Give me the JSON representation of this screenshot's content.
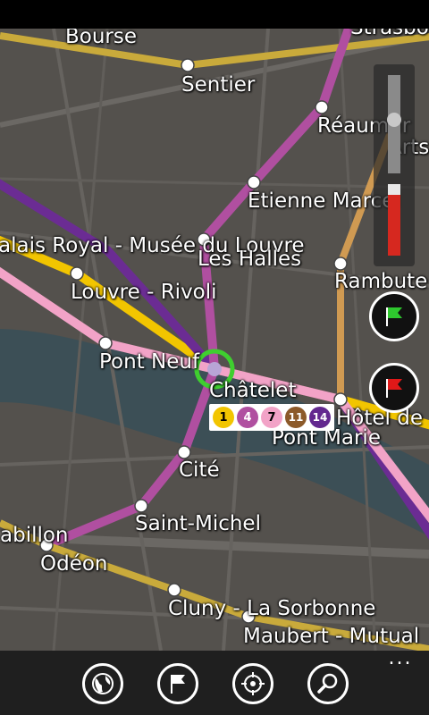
{
  "map": {
    "station_labels": {
      "bourse": "Bourse",
      "sentier": "Sentier",
      "strasbourg": "Strasbo",
      "reaumur": "Réaumur",
      "arts": "Arts",
      "etienne_marcel": "Etienne Marcel",
      "palais_royal": "alais Royal - Musée du Louvre",
      "les_halles": "Les Halles",
      "rambuteau": "Rambute",
      "louvre_rivoli": "Louvre - Rivoli",
      "pont_neuf": "Pont Neuf",
      "chatelet": "Châtelet",
      "hotel_de_ville": "Hôtel de",
      "pont_marie": "Pont Marie",
      "cite": "Cité",
      "saint_michel": "Saint-Michel",
      "mabillon": "abillon",
      "odeon": "Odéon",
      "cluny": "Cluny - La Sorbonne",
      "maubert": "Maubert - Mutual"
    },
    "selected_station_lines": [
      {
        "number": "1",
        "color": "#f2c500",
        "text_color": "#000000"
      },
      {
        "number": "4",
        "color": "#b04fa0",
        "text_color": "#ffffff"
      },
      {
        "number": "7",
        "color": "#f2a3c7",
        "text_color": "#000000"
      },
      {
        "number": "11",
        "color": "#8c5a2a",
        "text_color": "#ffffff"
      },
      {
        "number": "14",
        "color": "#63288f",
        "text_color": "#ffffff"
      }
    ],
    "line_colors": {
      "line1": "#f2c500",
      "line4": "#b04fa0",
      "line7": "#f2a3c7",
      "line11": "#d09a52",
      "line14": "#6b2c93",
      "selection_ring": "#3fcf2f"
    }
  },
  "controls": {
    "zoom_level": 0.55,
    "start_flag_color": "#2ec82e",
    "end_flag_color": "#e01818"
  },
  "app_bar": {
    "buttons": [
      "globe-icon",
      "flag-icon",
      "locate-icon",
      "search-icon"
    ],
    "more": "..."
  }
}
